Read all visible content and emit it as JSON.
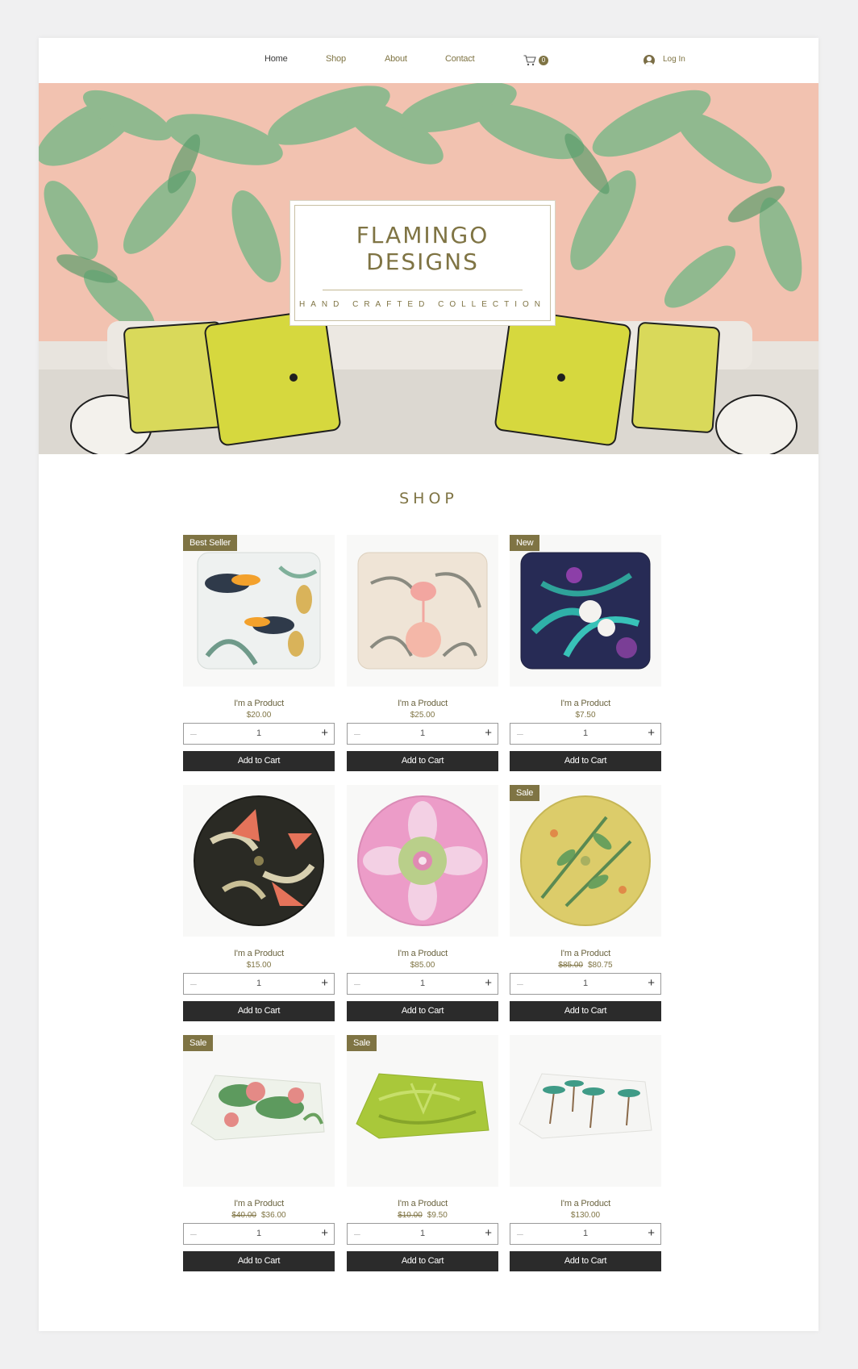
{
  "nav": {
    "items": [
      {
        "label": "Home"
      },
      {
        "label": "Shop"
      },
      {
        "label": "About"
      },
      {
        "label": "Contact"
      }
    ],
    "cart_count": "0",
    "login_label": "Log In"
  },
  "hero": {
    "title_line1": "FLAMINGO",
    "title_line2": "DESIGNS",
    "subtitle": "HAND CRAFTED COLLECTION"
  },
  "shop": {
    "title": "SHOP",
    "add_to_cart_label": "Add to Cart",
    "products": [
      {
        "name": "I'm a Product",
        "price": "$20.00",
        "old_price": "",
        "badge": "Best Seller",
        "qty": "1",
        "image": "square-cushion-toucan-pineapple"
      },
      {
        "name": "I'm a Product",
        "price": "$25.00",
        "old_price": "",
        "badge": "",
        "qty": "1",
        "image": "square-cushion-flamingo-palm"
      },
      {
        "name": "I'm a Product",
        "price": "$7.50",
        "old_price": "",
        "badge": "New",
        "qty": "1",
        "image": "square-cushion-orchid-navy"
      },
      {
        "name": "I'm a Product",
        "price": "$15.00",
        "old_price": "",
        "badge": "",
        "qty": "1",
        "image": "round-cushion-bird-of-paradise-black"
      },
      {
        "name": "I'm a Product",
        "price": "$85.00",
        "old_price": "",
        "badge": "",
        "qty": "1",
        "image": "round-cushion-pink-floral"
      },
      {
        "name": "I'm a Product",
        "price": "$80.75",
        "old_price": "$85.00",
        "badge": "Sale",
        "qty": "1",
        "image": "round-cushion-yellow-botanical"
      },
      {
        "name": "I'm a Product",
        "price": "$36.00",
        "old_price": "$40.00",
        "badge": "Sale",
        "qty": "1",
        "image": "folded-throw-tropical-floral"
      },
      {
        "name": "I'm a Product",
        "price": "$9.50",
        "old_price": "$10.00",
        "badge": "Sale",
        "qty": "1",
        "image": "folded-throw-green-palm"
      },
      {
        "name": "I'm a Product",
        "price": "$130.00",
        "old_price": "",
        "badge": "",
        "qty": "1",
        "image": "folded-throw-white-palm-trees"
      }
    ]
  },
  "colors": {
    "accent": "#7f7444",
    "button": "#2b2b2b",
    "hero_bg": "#f2c2b0",
    "background": "#f0f0f1"
  },
  "icons": {
    "cart": "cart-icon",
    "login": "user-avatar-icon",
    "minus": "minus-icon",
    "plus": "plus-icon"
  }
}
